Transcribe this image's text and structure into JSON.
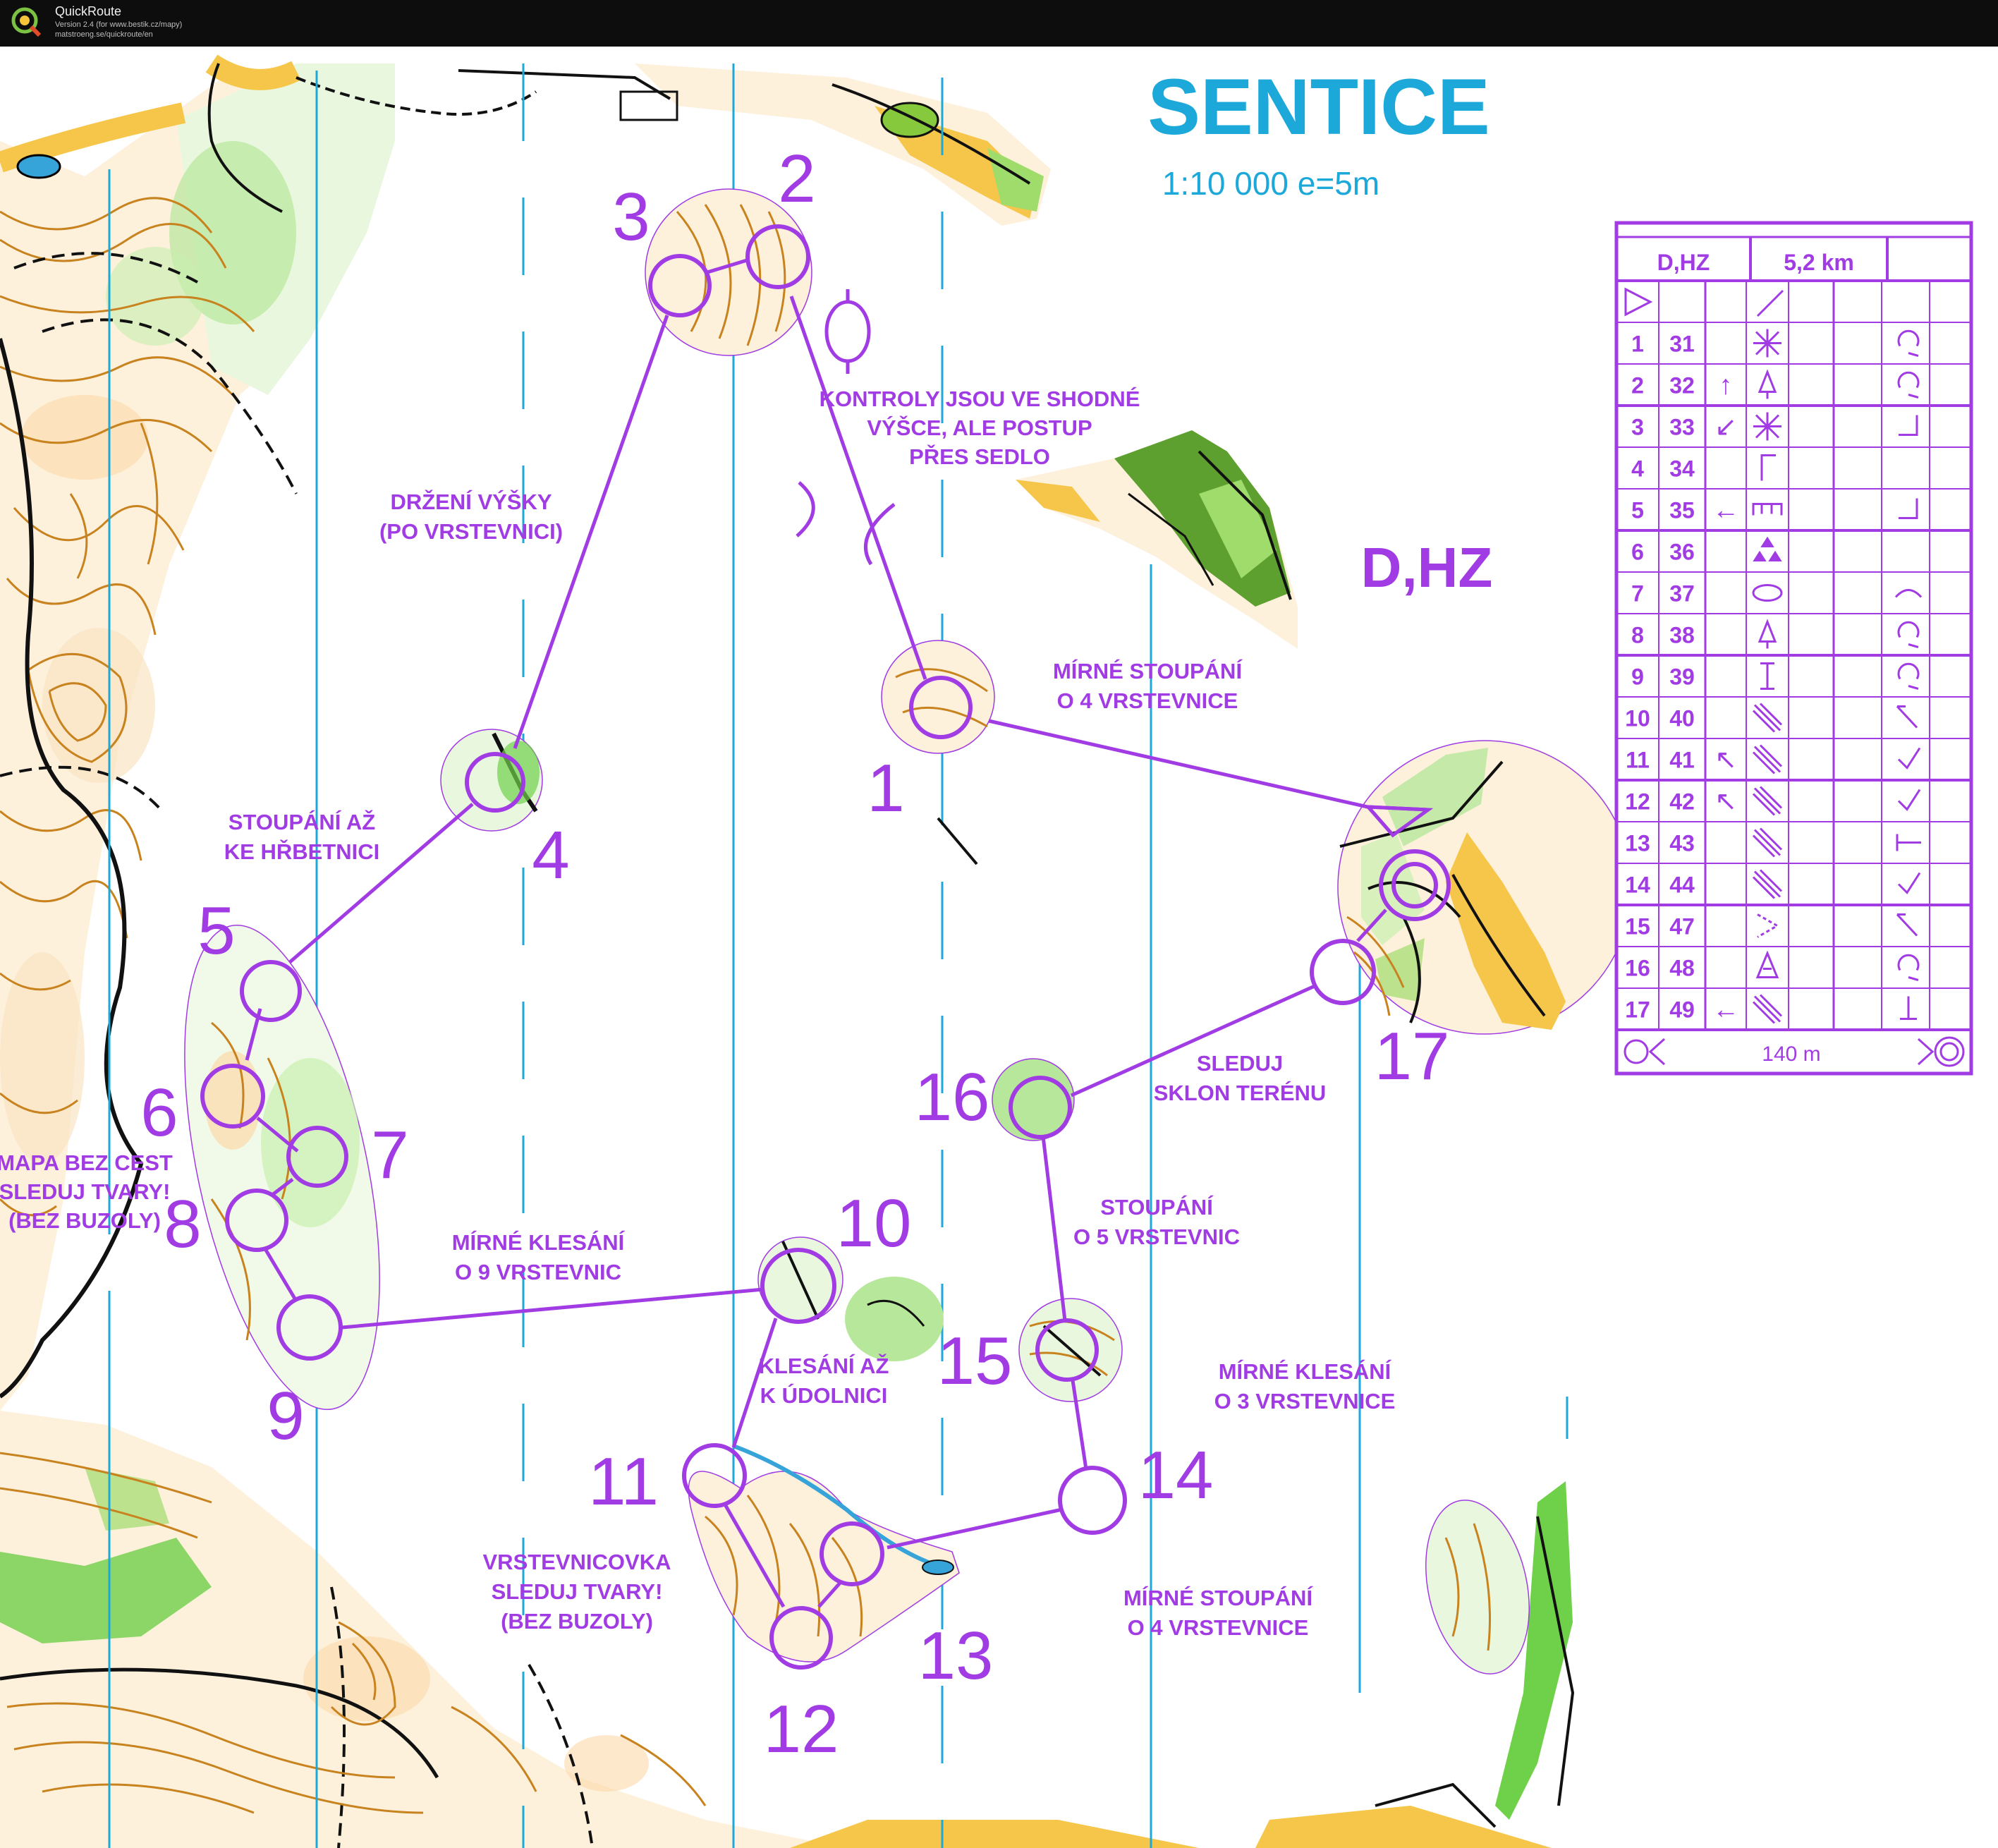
{
  "window": {
    "app_title": "QuickRoute",
    "version_line": "Version 2.4  (for www.bestik.cz/mapy)",
    "url_line": "matstroeng.se/quickroute/en"
  },
  "map": {
    "title": "SENTICE",
    "scale": "1:10 000 e=5m",
    "category": "D,HZ",
    "colors": {
      "course": "#a13be3",
      "title": "#1ca9d9",
      "meridian": "#1ca9d9",
      "contour": "#c8821e",
      "vegetation": "#6fd04a",
      "open_land": "#f6c64a"
    },
    "notes": {
      "n1": [
        "KONTROLY JSOU VE SHODNÉ",
        "VÝŠCE, ALE POSTUP",
        "PŘES SEDLO"
      ],
      "n2": [
        "DRŽENÍ VÝŠKY",
        "(PO VRSTEVNICI)"
      ],
      "n3": [
        "MÍRNÉ STOUPÁNÍ",
        "O 4 VRSTEVNICE"
      ],
      "n4": [
        "STOUPÁNÍ AŽ",
        "KE HŘBETNICI"
      ],
      "n5": [
        "MAPA BEZ CEST",
        "SLEDUJ TVARY!",
        "(BEZ BUZOLY)"
      ],
      "n6": [
        "SLEDUJ",
        "SKLON TERÉNU"
      ],
      "n7": [
        "STOUPÁNÍ",
        "O 5 VRSTEVNIC"
      ],
      "n8": [
        "MÍRNÉ KLESÁNÍ",
        "O 9 VRSTEVNIC"
      ],
      "n9": [
        "KLESÁNÍ AŽ",
        "K ÚDOLNICI"
      ],
      "n10": [
        "MÍRNÉ KLESÁNÍ",
        "O 3 VRSTEVNICE"
      ],
      "n11": [
        "VRSTEVNICOVKA",
        "SLEDUJ TVARY!",
        "(BEZ BUZOLY)"
      ],
      "n12": [
        "MÍRNÉ STOUPÁNÍ",
        "O 4 VRSTEVNICE"
      ]
    },
    "control_labels": [
      "1",
      "2",
      "3",
      "4",
      "5",
      "6",
      "7",
      "8",
      "9",
      "10",
      "11",
      "12",
      "13",
      "14",
      "15",
      "16",
      "17"
    ]
  },
  "description": {
    "header_category": "D,HZ",
    "header_length": "5,2 km",
    "rows": [
      {
        "n": "1",
        "code": "31",
        "dir": "",
        "feature": "gully",
        "where": "hollow"
      },
      {
        "n": "2",
        "code": "32",
        "dir": "↑",
        "feature": "tree",
        "where": "hollow"
      },
      {
        "n": "3",
        "code": "33",
        "dir": "↙",
        "feature": "gully",
        "where": "corner"
      },
      {
        "n": "4",
        "code": "34",
        "dir": "",
        "feature": "fence-corner",
        "where": ""
      },
      {
        "n": "5",
        "code": "35",
        "dir": "←",
        "feature": "ruin",
        "where": "corner"
      },
      {
        "n": "6",
        "code": "36",
        "dir": "",
        "feature": "stones",
        "where": ""
      },
      {
        "n": "7",
        "code": "37",
        "dir": "",
        "feature": "oval",
        "where": "arc"
      },
      {
        "n": "8",
        "code": "38",
        "dir": "",
        "feature": "tree",
        "where": "hollow"
      },
      {
        "n": "9",
        "code": "39",
        "dir": "",
        "feature": "post",
        "where": "hollow"
      },
      {
        "n": "10",
        "code": "40",
        "dir": "",
        "feature": "stripe",
        "where": "check"
      },
      {
        "n": "11",
        "code": "41",
        "dir": "↖",
        "feature": "stripe",
        "where": "tick"
      },
      {
        "n": "12",
        "code": "42",
        "dir": "↖",
        "feature": "stripe",
        "where": "tick"
      },
      {
        "n": "13",
        "code": "43",
        "dir": "",
        "feature": "stripe",
        "where": "end"
      },
      {
        "n": "14",
        "code": "44",
        "dir": "",
        "feature": "stripe",
        "where": "tick"
      },
      {
        "n": "15",
        "code": "47",
        "dir": "",
        "feature": "vee",
        "where": "check"
      },
      {
        "n": "16",
        "code": "48",
        "dir": "",
        "feature": "conifer",
        "where": "hollow"
      },
      {
        "n": "17",
        "code": "49",
        "dir": "←",
        "feature": "stripe",
        "where": "foot"
      }
    ],
    "footer_distance": "140 m"
  }
}
